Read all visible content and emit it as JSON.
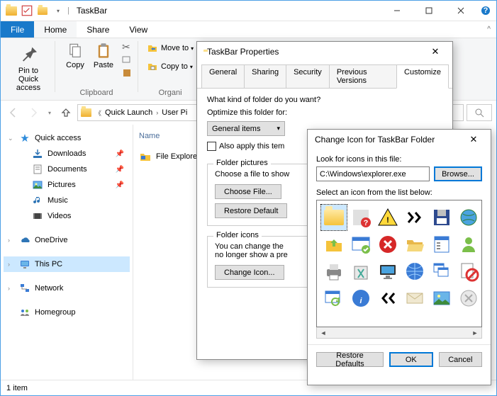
{
  "window": {
    "title": "TaskBar",
    "status": "1 item"
  },
  "menu": {
    "file": "File",
    "home": "Home",
    "share": "Share",
    "view": "View"
  },
  "ribbon": {
    "pin": "Pin to Quick\naccess",
    "copy": "Copy",
    "paste": "Paste",
    "move_to": "Move to",
    "copy_to": "Copy to",
    "clipboard_group": "Clipboard",
    "organize_group": "Organi"
  },
  "breadcrumb": {
    "items": [
      "Quick Launch",
      "User Pi"
    ]
  },
  "nav": {
    "quick_access": "Quick access",
    "downloads": "Downloads",
    "documents": "Documents",
    "pictures": "Pictures",
    "music": "Music",
    "videos": "Videos",
    "onedrive": "OneDrive",
    "this_pc": "This PC",
    "network": "Network",
    "homegroup": "Homegroup"
  },
  "list": {
    "header_name": "Name",
    "file_explorer": "File Explorer"
  },
  "props": {
    "title": "TaskBar Properties",
    "tabs": {
      "general": "General",
      "sharing": "Sharing",
      "security": "Security",
      "previous": "Previous Versions",
      "customize": "Customize"
    },
    "q1": "What kind of folder do you want?",
    "optimize": "Optimize this folder for:",
    "optimize_value": "General items",
    "also_apply": "Also apply this tem",
    "folder_pictures": "Folder pictures",
    "choose_file_label": "Choose a file to show",
    "choose_file_btn": "Choose File...",
    "restore_default_btn": "Restore Default",
    "folder_icons": "Folder icons",
    "change_desc": "You can change the\nno longer show a pre",
    "change_icon_btn": "Change Icon..."
  },
  "changeicon": {
    "title": "Change Icon for TaskBar Folder",
    "look": "Look for icons in this file:",
    "path": "C:\\Windows\\explorer.exe",
    "browse": "Browse...",
    "select": "Select an icon from the list below:",
    "restore": "Restore Defaults",
    "ok": "OK",
    "cancel": "Cancel"
  }
}
